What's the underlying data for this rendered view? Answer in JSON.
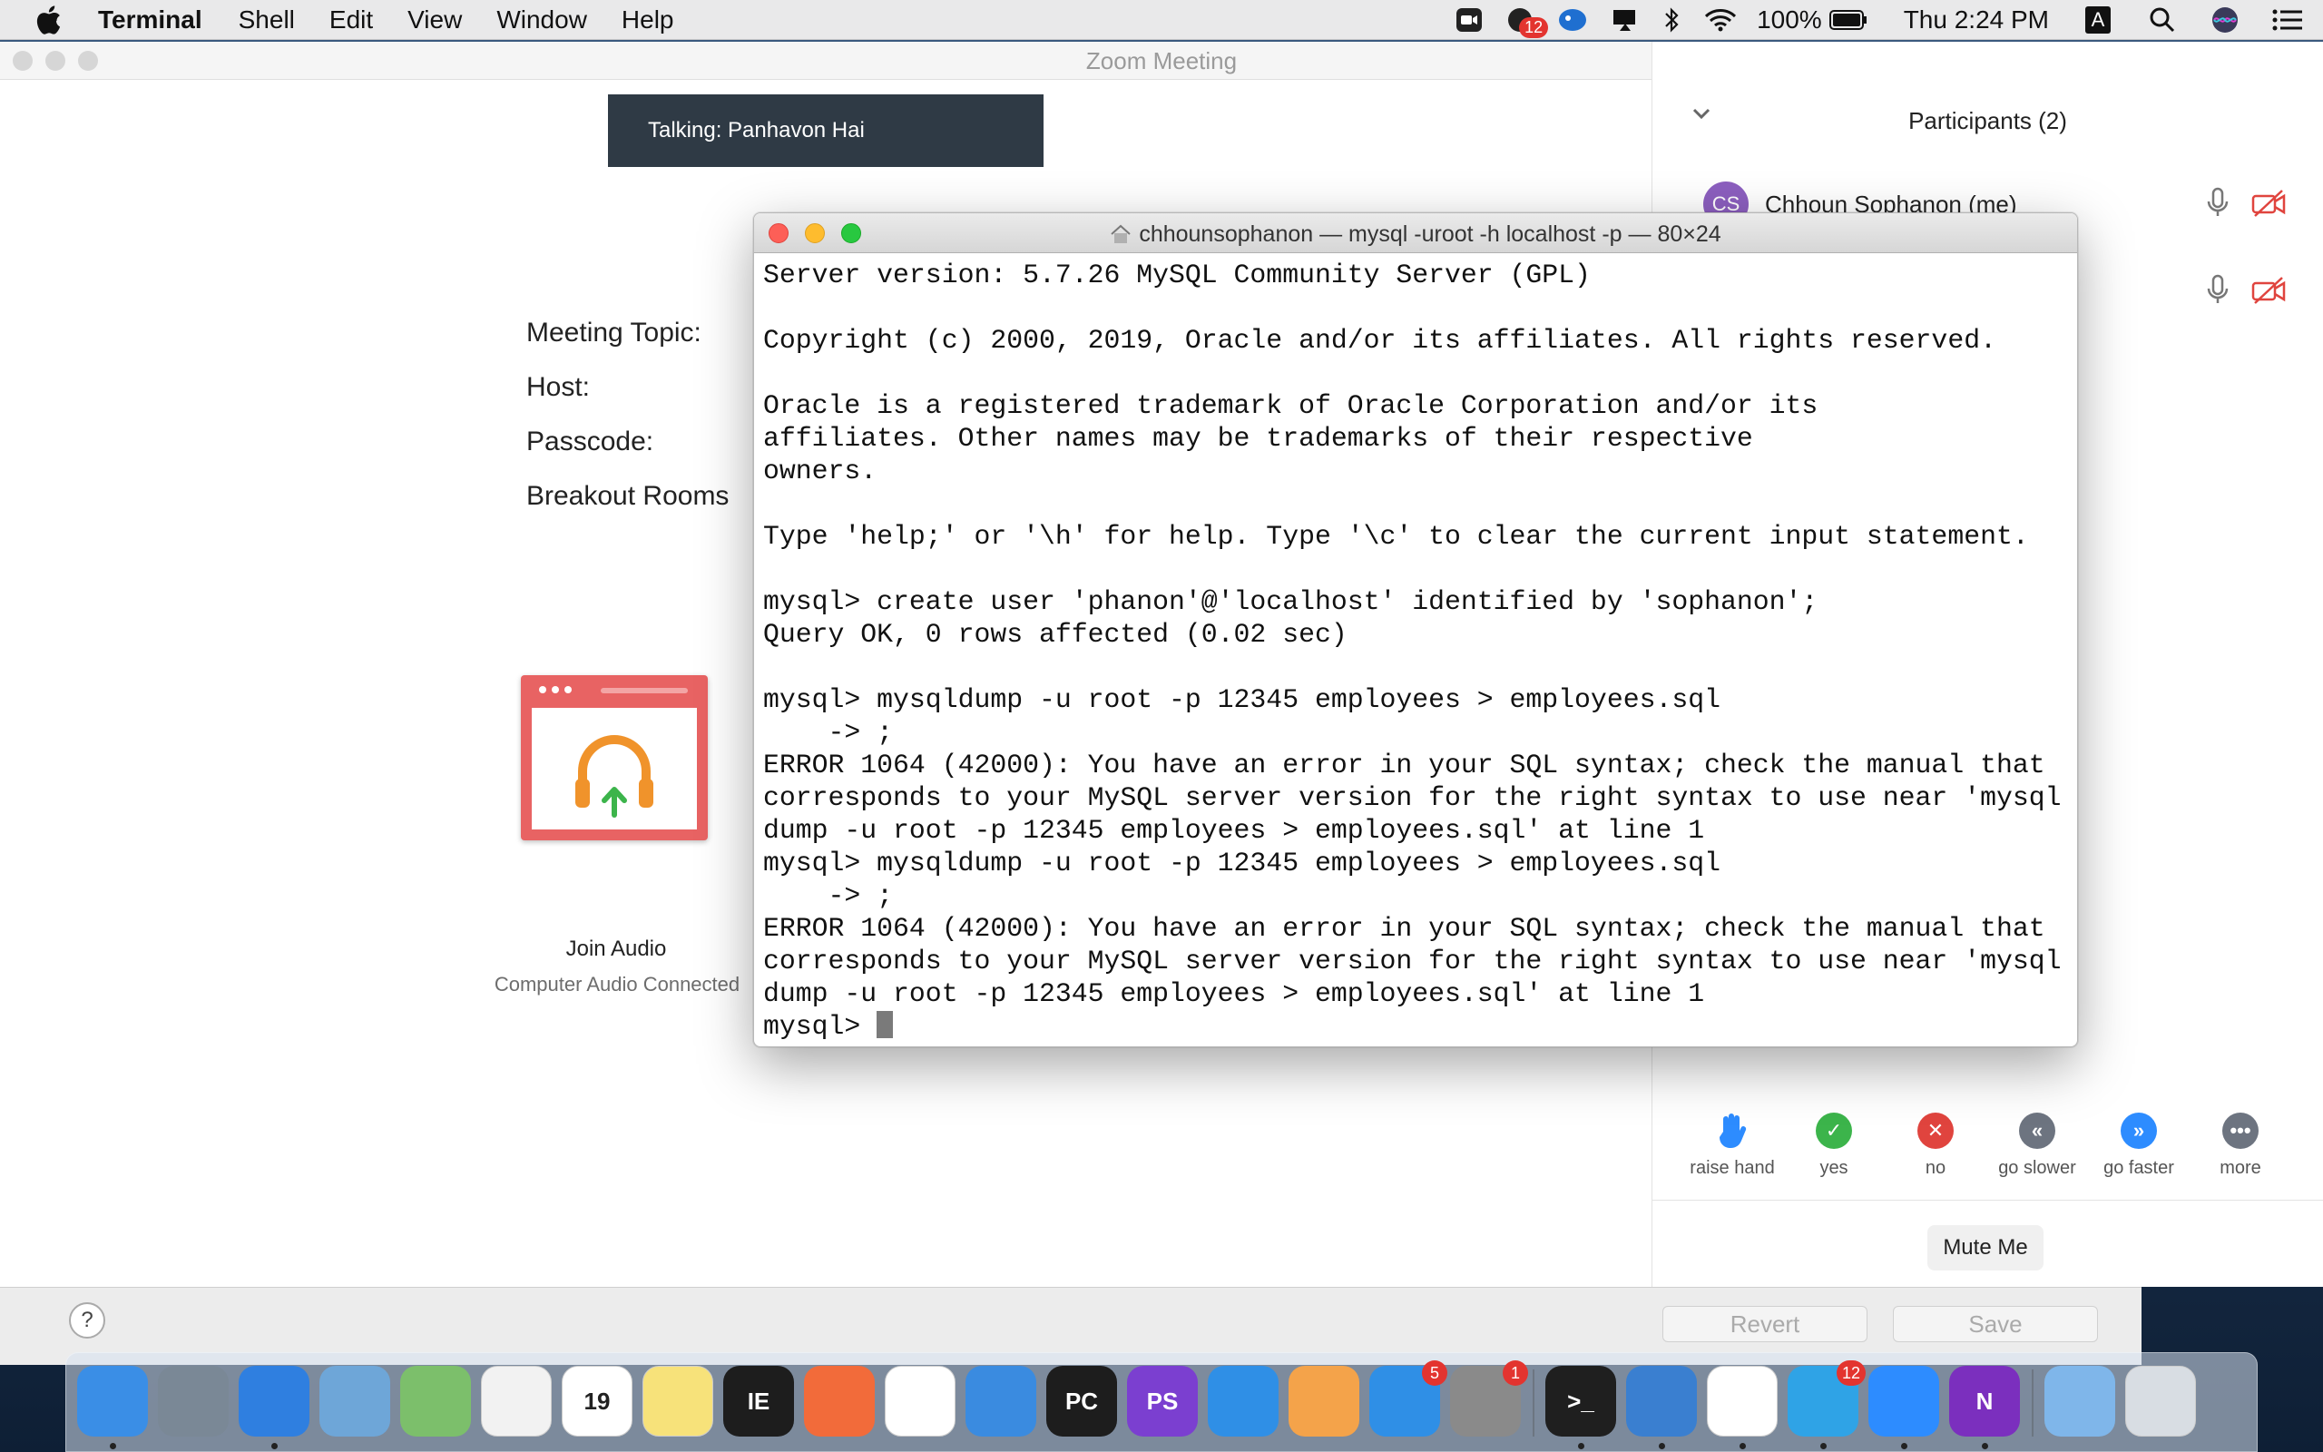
{
  "menubar": {
    "app_name": "Terminal",
    "menus": [
      "Shell",
      "Edit",
      "View",
      "Window",
      "Help"
    ],
    "battery": "100%",
    "clock": "Thu 2:24 PM",
    "input_source": "A",
    "notification_badge": "12"
  },
  "zoom": {
    "window_title": "Zoom Meeting",
    "talking": "Talking: Panhavon Hai",
    "info_labels": [
      "Meeting Topic:",
      "Host:",
      "Passcode:",
      "Breakout Rooms"
    ],
    "join_audio": "Join Audio",
    "audio_status": "Computer Audio Connected",
    "participants_title": "Participants (2)",
    "participants": [
      {
        "initials": "CS",
        "name": "Chhoun Sophanon (me)"
      },
      {
        "initials": "",
        "name": ""
      }
    ],
    "reactions": [
      {
        "label": "raise hand",
        "icon": "raise-hand-icon",
        "color": "#2d8cff"
      },
      {
        "label": "yes",
        "icon": "check-icon",
        "color": "#3cb44b"
      },
      {
        "label": "no",
        "icon": "x-icon",
        "color": "#e0443e"
      },
      {
        "label": "go slower",
        "icon": "rewind-icon",
        "color": "#6d7480"
      },
      {
        "label": "go faster",
        "icon": "fast-forward-icon",
        "color": "#2d8cff"
      },
      {
        "label": "more",
        "icon": "more-icon",
        "color": "#6d7480"
      }
    ],
    "mute_button": "Mute Me"
  },
  "lower_sheet": {
    "help": "?",
    "revert": "Revert",
    "save": "Save"
  },
  "terminal": {
    "title": "chhounsophanon — mysql -uroot -h localhost -p — 80×24",
    "lines": [
      "Server version: 5.7.26 MySQL Community Server (GPL)",
      "",
      "Copyright (c) 2000, 2019, Oracle and/or its affiliates. All rights reserved.",
      "",
      "Oracle is a registered trademark of Oracle Corporation and/or its",
      "affiliates. Other names may be trademarks of their respective",
      "owners.",
      "",
      "Type 'help;' or '\\h' for help. Type '\\c' to clear the current input statement.",
      "",
      "mysql> create user 'phanon'@'localhost' identified by 'sophanon';",
      "Query OK, 0 rows affected (0.02 sec)",
      "",
      "mysql> mysqldump -u root -p 12345 employees > employees.sql",
      "    -> ;",
      "ERROR 1064 (42000): You have an error in your SQL syntax; check the manual that",
      "corresponds to your MySQL server version for the right syntax to use near 'mysql",
      "dump -u root -p 12345 employees > employees.sql' at line 1",
      "mysql> mysqldump -u root -p 12345 employees > employees.sql",
      "    -> ;",
      "ERROR 1064 (42000): You have an error in your SQL syntax; check the manual that",
      "corresponds to your MySQL server version for the right syntax to use near 'mysql",
      "dump -u root -p 12345 employees > employees.sql' at line 1"
    ],
    "prompt": "mysql> "
  },
  "dock": {
    "apps": [
      {
        "name": "finder-icon",
        "color": "#3a8ee6",
        "label": "",
        "running": true
      },
      {
        "name": "launchpad-icon",
        "color": "#7a8896",
        "label": "",
        "running": false
      },
      {
        "name": "safari-icon",
        "color": "#2f7fe0",
        "label": "",
        "running": true
      },
      {
        "name": "preview-icon",
        "color": "#6ea6d8",
        "label": "",
        "running": false
      },
      {
        "name": "maps-icon",
        "color": "#7cbf6b",
        "label": "",
        "running": false
      },
      {
        "name": "photos-icon",
        "color": "#f2f2f2",
        "label": "",
        "running": false
      },
      {
        "name": "calendar-icon",
        "color": "#ffffff",
        "label": "19",
        "running": false
      },
      {
        "name": "notes-icon",
        "color": "#f7e27a",
        "label": "",
        "running": false
      },
      {
        "name": "intellij-icon",
        "color": "#1d1d1d",
        "label": "IE",
        "running": false
      },
      {
        "name": "postman-icon",
        "color": "#f26b3a",
        "label": "",
        "running": false
      },
      {
        "name": "app-inspector-icon",
        "color": "#ffffff",
        "label": "",
        "running": false
      },
      {
        "name": "xcode-icon",
        "color": "#3a8be0",
        "label": "",
        "running": false
      },
      {
        "name": "pycharm-icon",
        "color": "#1d1d1d",
        "label": "PC",
        "running": false
      },
      {
        "name": "phpstorm-icon",
        "color": "#7b3fd0",
        "label": "PS",
        "running": false
      },
      {
        "name": "vscode-icon",
        "color": "#2f8fe6",
        "label": "",
        "running": false
      },
      {
        "name": "pages-icon",
        "color": "#f4a34a",
        "label": "",
        "running": false
      },
      {
        "name": "app-store-icon",
        "color": "#2f8fe6",
        "label": "",
        "badge": "5",
        "running": false
      },
      {
        "name": "system-preferences-icon",
        "color": "#8a8a8a",
        "label": "",
        "badge": "1",
        "running": false
      },
      {
        "name": "terminal-icon",
        "color": "#1f1f1f",
        "label": ">_",
        "running": true
      },
      {
        "name": "tableplus-icon",
        "color": "#3a7fd0",
        "label": "",
        "running": true
      },
      {
        "name": "chrome-icon",
        "color": "#ffffff",
        "label": "",
        "running": true
      },
      {
        "name": "telegram-icon",
        "color": "#2fa3e6",
        "label": "",
        "badge": "12",
        "running": true
      },
      {
        "name": "zoom-icon",
        "color": "#2d8cff",
        "label": "",
        "running": true
      },
      {
        "name": "onenote-icon",
        "color": "#7b2fbe",
        "label": "N",
        "running": true
      },
      {
        "name": "downloads-folder-icon",
        "color": "#7fb6ea",
        "label": "",
        "running": false
      },
      {
        "name": "trash-icon",
        "color": "#d8dde3",
        "label": "",
        "running": false
      }
    ]
  }
}
